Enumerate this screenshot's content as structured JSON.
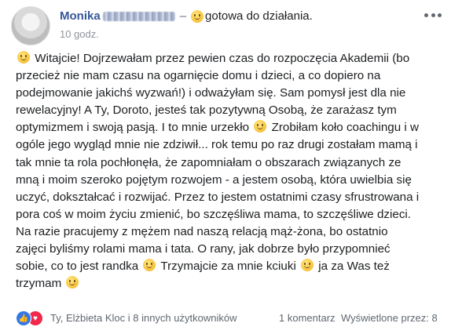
{
  "post": {
    "author": "Monika",
    "dash": "–",
    "feeling": "gotowa do działania.",
    "time": "10 godz.",
    "text_lines": [
      "Witajcie! Dojrzewałam przez pewien czas do rozpoczęcia Akademii (bo",
      "przecież nie mam czasu na ogarnięcie domu i dzieci, a co dopiero na",
      "podejmowanie jakichś wyzwań!) i odważyłam się. Sam pomysł jest dla nie",
      "rewelacyjny! A Ty, Doroto, jesteś tak pozytywną Osobą, że zarażasz tym",
      "optymizmem i swoją pasją. I to mnie urzekło",
      "Zrobiłam koło coachingu i w",
      "ogóle jego wygląd mnie nie zdziwił... rok temu po raz drugi zostałam mamą i",
      "tak mnie ta rola pochłonęła, że zapomniałam o obszarach związanych ze",
      "mną i moim szeroko pojętym rozwojem - a jestem osobą, która uwielbia się",
      "uczyć, dokształcać i rozwijać. Przez to jestem ostatnimi czasy sfrustrowana i",
      "pora coś w moim życiu zmienić, bo szczęśliwa mama, to szczęśliwe dzieci.",
      "Na razie pracujemy z mężem nad naszą relacją mąż-żona, bo ostatnio",
      "zajęci byliśmy rolami mama i tata. O rany, jak dobrze było przypomnieć",
      "sobie, co to jest randka",
      "Trzymajcie za mnie kciuki",
      "ja za Was też",
      "trzymam"
    ]
  },
  "footer": {
    "reactions_text": "Ty, Elżbieta Kloc i 8 innych użytkowników",
    "comments": "1 komentarz",
    "views": "Wyświetlone przez: 8"
  },
  "icons": {
    "emoji": "smiley-icon",
    "like": "like-icon",
    "love": "love-icon",
    "more": "more-options-icon"
  }
}
